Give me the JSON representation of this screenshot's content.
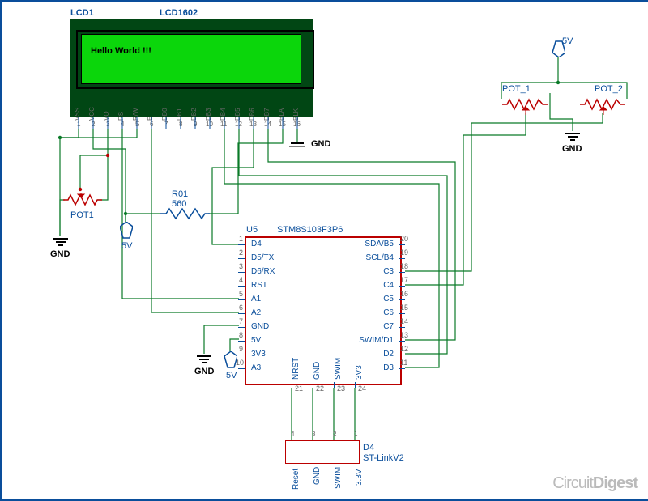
{
  "lcd": {
    "refdes": "LCD1",
    "part": "LCD1602",
    "display_text": "Hello World !!!",
    "pins": [
      "VSS",
      "VCC",
      "VO",
      "RS",
      "R/W",
      "E",
      "DB0",
      "DB1",
      "DB2",
      "DB3",
      "DB4",
      "DB5",
      "DB6",
      "DB7",
      "BLA",
      "BLK"
    ],
    "pin_nums": [
      "1",
      "2",
      "3",
      "4",
      "5",
      "6",
      "7",
      "8",
      "9",
      "10",
      "11",
      "12",
      "13",
      "14",
      "15",
      "16"
    ]
  },
  "mcu": {
    "refdes": "U5",
    "part": "STM8S103F3P6",
    "left_pins": [
      {
        "n": "1",
        "l": "D4"
      },
      {
        "n": "2",
        "l": "D5/TX"
      },
      {
        "n": "3",
        "l": "D6/RX"
      },
      {
        "n": "4",
        "l": "RST"
      },
      {
        "n": "5",
        "l": "A1"
      },
      {
        "n": "6",
        "l": "A2"
      },
      {
        "n": "7",
        "l": "GND"
      },
      {
        "n": "8",
        "l": "5V"
      },
      {
        "n": "9",
        "l": "3V3"
      },
      {
        "n": "10",
        "l": "A3"
      }
    ],
    "right_pins": [
      {
        "n": "20",
        "l": "SDA/B5"
      },
      {
        "n": "19",
        "l": "SCL/B4"
      },
      {
        "n": "18",
        "l": "C3"
      },
      {
        "n": "17",
        "l": "C4"
      },
      {
        "n": "16",
        "l": "C5"
      },
      {
        "n": "15",
        "l": "C6"
      },
      {
        "n": "14",
        "l": "C7"
      },
      {
        "n": "13",
        "l": "SWIM/D1"
      },
      {
        "n": "12",
        "l": "D2"
      },
      {
        "n": "11",
        "l": "D3"
      }
    ],
    "bottom_pins": [
      {
        "n": "21",
        "l": "NRST"
      },
      {
        "n": "22",
        "l": "GND"
      },
      {
        "n": "23",
        "l": "SWIM"
      },
      {
        "n": "24",
        "l": "3V3"
      }
    ]
  },
  "resistor": {
    "refdes": "R01",
    "value": "560"
  },
  "pots": {
    "contrast": "POT1",
    "adc1": "POT_1",
    "adc2": "POT_2"
  },
  "connector": {
    "refdes": "D4",
    "part": "ST-LinkV2",
    "pins": [
      "Reset",
      "GND",
      "SWIM",
      "3.3V"
    ],
    "nums": [
      "4",
      "3",
      "2",
      "1"
    ]
  },
  "net": {
    "v5": "5V",
    "gnd": "GND"
  },
  "watermark": [
    "Circuit",
    "Digest"
  ]
}
